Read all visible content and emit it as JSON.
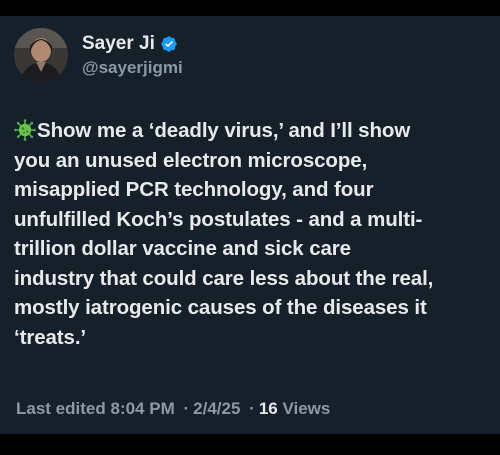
{
  "author": {
    "display_name": "Sayer Ji",
    "handle": "@sayerjigmi",
    "verified": true,
    "verified_color": "#1d9bf0"
  },
  "tweet": {
    "leading_icon": "virus-icon",
    "lines": [
      "Show me a ‘deadly virus,’ and I’ll show",
      "you an unused electron microscope,",
      "misapplied PCR technology, and four",
      "unfulfilled Koch’s postulates - and a multi-",
      "trillion dollar vaccine and sick care",
      "industry that could care less about the real,",
      "mostly iatrogenic causes of the diseases it",
      "‘treats.’"
    ]
  },
  "meta": {
    "edited_label": "Last edited",
    "time": "8:04 PM",
    "separator": "·",
    "date": "2/4/25",
    "views_count": "16",
    "views_label": "Views"
  },
  "colors": {
    "background": "#15202b",
    "text": "#e7e9ea",
    "secondary_text": "#8b98a5"
  }
}
